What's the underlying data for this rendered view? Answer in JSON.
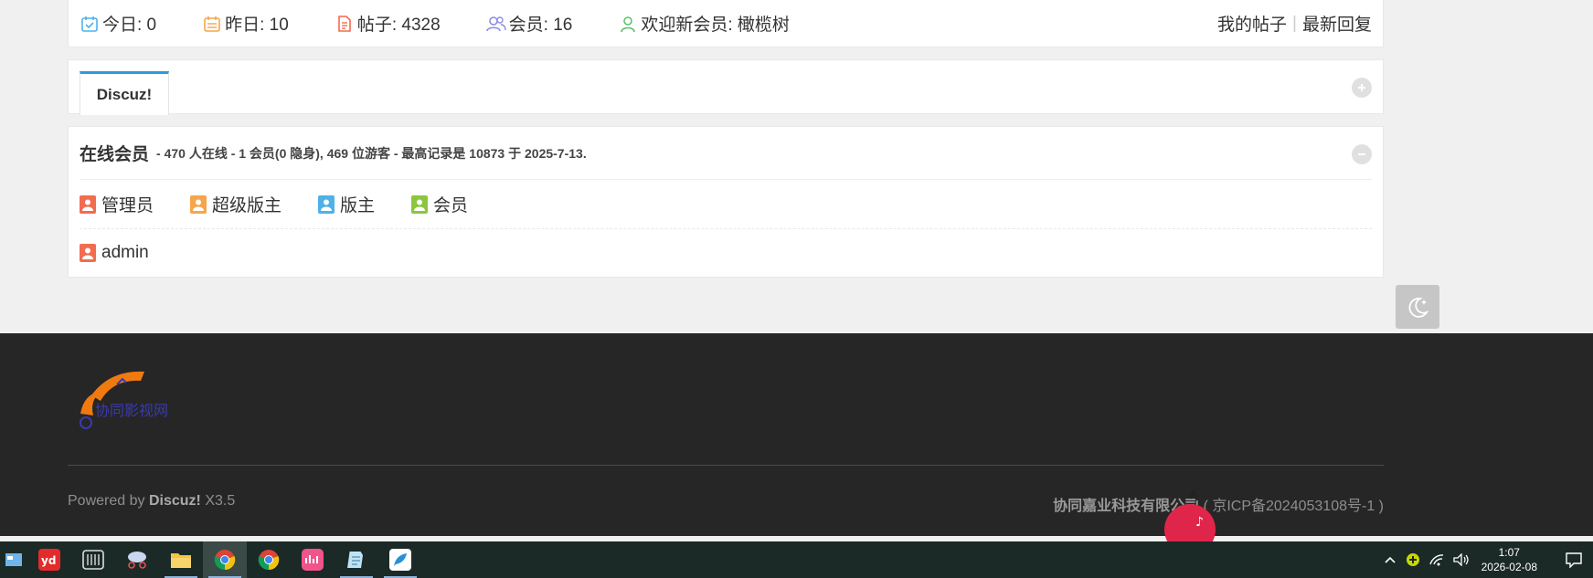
{
  "stats": {
    "today": "今日: 0",
    "yesterday": "昨日: 10",
    "posts": "帖子: 4328",
    "members": "会员: 16",
    "welcome": "欢迎新会员: 橄榄树",
    "my_posts": "我的帖子",
    "latest_replies": "最新回复"
  },
  "tab": {
    "label": "Discuz!"
  },
  "online": {
    "title": "在线会员",
    "info": "- 470 人在线 - 1 会员(0 隐身), 469 位游客 - 最高记录是 10873 于 2025-7-13.",
    "legend": [
      {
        "label": "管理员",
        "color": "#f26c4f"
      },
      {
        "label": "超级版主",
        "color": "#f5a64a"
      },
      {
        "label": "版主",
        "color": "#4fb1e8"
      },
      {
        "label": "会员",
        "color": "#8cc63e"
      }
    ],
    "users": [
      {
        "name": "admin",
        "color": "#f26c4f"
      }
    ]
  },
  "footer": {
    "powered_prefix": "Powered by",
    "powered_brand": "Discuz!",
    "powered_version": "X3.5",
    "company": "协同嘉业科技有限公司",
    "icp": "( 京ICP备2024053108号-1 )"
  },
  "taskbar": {
    "time": "1:07",
    "date": "2026-02-08"
  },
  "colors": {
    "accent": "#2d9bd7",
    "footer_bg": "#262626",
    "taskbar_bg": "#1b2a27"
  }
}
